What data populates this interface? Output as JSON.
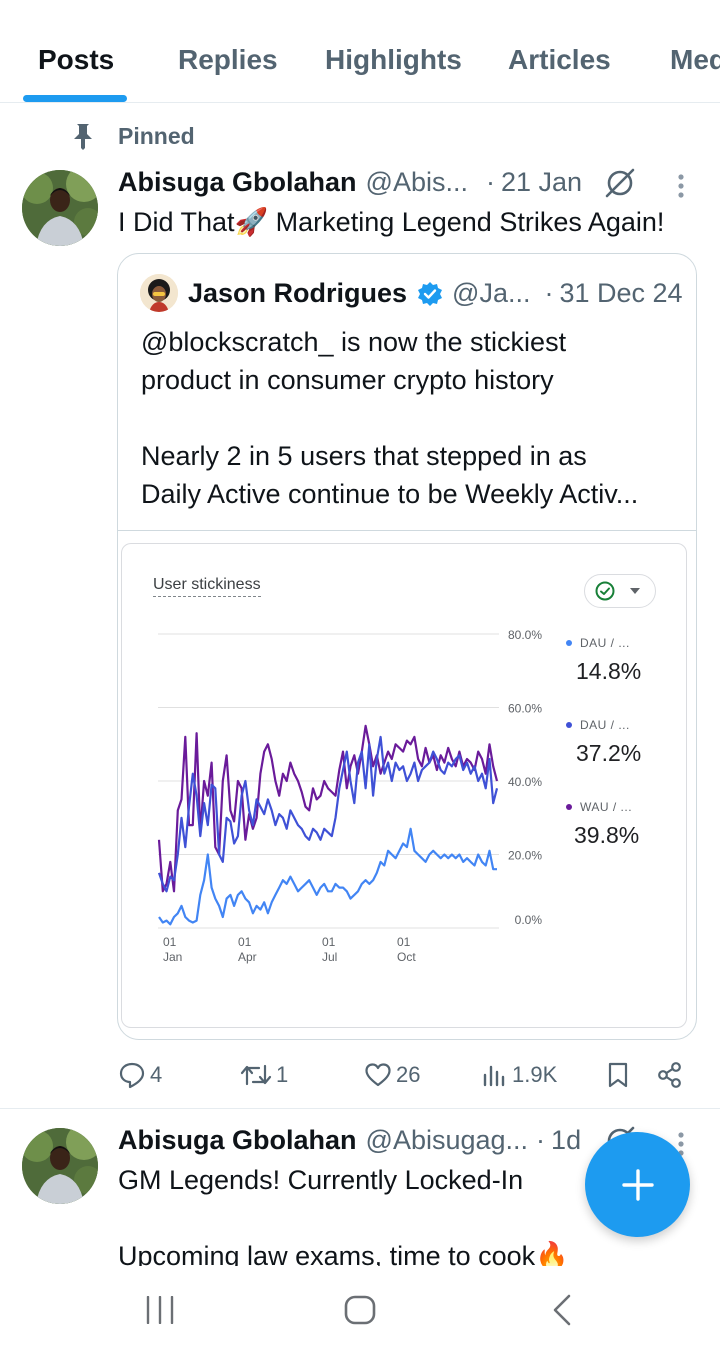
{
  "tabs": [
    {
      "label": "Posts",
      "active": true
    },
    {
      "label": "Replies",
      "active": false
    },
    {
      "label": "Highlights",
      "active": false
    },
    {
      "label": "Articles",
      "active": false
    },
    {
      "label": "Media",
      "active": false
    }
  ],
  "pinned": {
    "label": "Pinned"
  },
  "tweet1": {
    "name": "Abisuga Gbolahan",
    "handle": "@Abis...",
    "separator": "·",
    "date": "21 Jan",
    "text": "I Did That🚀 Marketing Legend Strikes Again!",
    "quote": {
      "name": "Jason Rodrigues",
      "handle": "@Ja...",
      "separator": "·",
      "date": "31 Dec 24",
      "lines": [
        "@blockscratch_ is now the stickiest",
        "product in consumer crypto history",
        "",
        "Nearly 2 in 5 users that stepped in as",
        "Daily Active continue to be Weekly Activ..."
      ]
    },
    "actions": {
      "replies": "4",
      "reposts": "1",
      "likes": "26",
      "views": "1.9K"
    }
  },
  "tweet2": {
    "name": "Abisuga Gbolahan",
    "handle": "@Abisugag...",
    "separator": "·",
    "date": "1d",
    "line1": "GM Legends! Currently Locked-In",
    "line2": "Upcoming law exams, time to cook🔥"
  },
  "colors": {
    "accent": "#1d9bf0",
    "series_dau_mau": "#4285f4",
    "series_dau_wau": "#3f51d6",
    "series_wau_mau": "#6a1b9a"
  },
  "chart_data": {
    "type": "line",
    "title": "User stickiness",
    "x_tick_labels": [
      [
        "01",
        "Jan"
      ],
      [
        "01",
        "Apr"
      ],
      [
        "01",
        "Jul"
      ],
      [
        "01",
        "Oct"
      ]
    ],
    "y_tick_labels": [
      "80.0%",
      "60.0%",
      "40.0%",
      "20.0%",
      "0.0%"
    ],
    "ylim": [
      0,
      80
    ],
    "grid": true,
    "legend_placement": "right",
    "series": [
      {
        "name": "DAU / ...",
        "display_value": "14.8%",
        "color": "#4285f4",
        "values": [
          3,
          1.5,
          2,
          1,
          3,
          4,
          6,
          3,
          2,
          1.5,
          2,
          9,
          13,
          20,
          11,
          8,
          6,
          3,
          8,
          9,
          6,
          9,
          10,
          8,
          7,
          4,
          6,
          5,
          7,
          4,
          7,
          9,
          11,
          13,
          12,
          14,
          12,
          10,
          11,
          12,
          13,
          11,
          9,
          11,
          12,
          10,
          10,
          12,
          11,
          11,
          10,
          8,
          9,
          10,
          12,
          13,
          12,
          13,
          15,
          18,
          17,
          21,
          20,
          19,
          21,
          23,
          22,
          27,
          21,
          20,
          19,
          18,
          20,
          21,
          20,
          19,
          20,
          19,
          20,
          19,
          20,
          18,
          19,
          18,
          17,
          20,
          18,
          17,
          21,
          16,
          16
        ]
      },
      {
        "name": "DAU / ...",
        "display_value": "37.2%",
        "color": "#3f51d6",
        "values": [
          15,
          12,
          10,
          14,
          13,
          20,
          30,
          22,
          33,
          42,
          36,
          25,
          34,
          28,
          39,
          38,
          20,
          18,
          30,
          29,
          23,
          25,
          36,
          40,
          32,
          28,
          35,
          33,
          31,
          35,
          32,
          28,
          31,
          30,
          27,
          32,
          30,
          28,
          27,
          25,
          24,
          27,
          26,
          24,
          27,
          26,
          25,
          30,
          38,
          43,
          48,
          40,
          34,
          45,
          48,
          38,
          50,
          36,
          46,
          52,
          42,
          45,
          40,
          45,
          43,
          44,
          40,
          42,
          45,
          40,
          43,
          44,
          45,
          48,
          46,
          43,
          42,
          45,
          44,
          46,
          47,
          43,
          45,
          42,
          44,
          40,
          42,
          38,
          46,
          34,
          38
        ]
      },
      {
        "name": "WAU / ...",
        "display_value": "39.8%",
        "color": "#6a1b9a",
        "values": [
          24,
          10,
          12,
          18,
          10,
          32,
          35,
          52,
          28,
          28,
          53,
          26,
          40,
          36,
          45,
          22,
          20,
          40,
          47,
          32,
          29,
          40,
          38,
          24,
          31,
          27,
          30,
          42,
          48,
          50,
          46,
          40,
          36,
          42,
          40,
          45,
          42,
          40,
          37,
          33,
          32,
          38,
          35,
          36,
          40,
          38,
          37,
          36,
          43,
          48,
          38,
          44,
          47,
          42,
          48,
          55,
          50,
          44,
          47,
          42,
          45,
          48,
          46,
          50,
          49,
          48,
          51,
          50,
          52,
          46,
          44,
          49,
          45,
          47,
          43,
          47,
          45,
          49,
          46,
          44,
          48,
          44,
          46,
          45,
          43,
          48,
          46,
          42,
          50,
          44,
          40
        ]
      }
    ]
  }
}
